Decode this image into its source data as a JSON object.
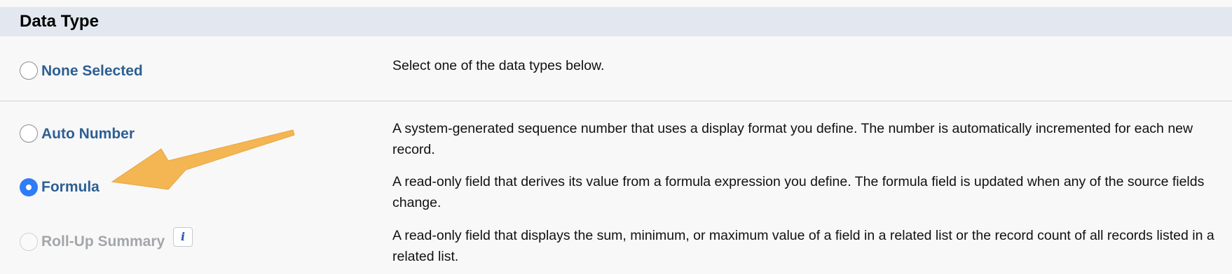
{
  "section": {
    "title": "Data Type"
  },
  "options": [
    {
      "label": "None Selected",
      "description": "Select one of the data types below.",
      "state": "unchecked"
    },
    {
      "label": "Auto Number",
      "description": "A system-generated sequence number that uses a display format you define. The number is automatically incremented for each new record.",
      "state": "unchecked"
    },
    {
      "label": "Formula",
      "description": "A read-only field that derives its value from a formula expression you define. The formula field is updated when any of the source fields change.",
      "state": "checked"
    },
    {
      "label": "Roll-Up Summary",
      "description": "A read-only field that displays the sum, minimum, or maximum value of a field in a related list or the record count of all records listed in a related list.",
      "state": "disabled",
      "info_icon": "i"
    }
  ],
  "annotation": {
    "type": "arrow",
    "color": "#f4b553",
    "points_to": "Formula"
  },
  "colors": {
    "header_bg": "#e3e7ef",
    "label_link": "#2d5f93",
    "label_disabled": "#a3a6aa",
    "radio_checked": "#2f7df6",
    "page_bg": "#f8f8f8"
  }
}
